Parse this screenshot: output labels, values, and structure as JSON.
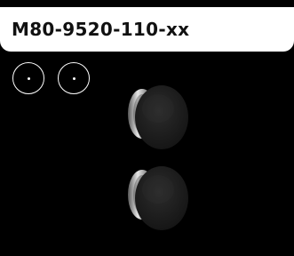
{
  "header": {
    "title": "M80-9520-110-xx"
  },
  "swatches": [
    {
      "icon": "color-swatch-icon",
      "selected": false
    },
    {
      "icon": "color-swatch-icon",
      "selected": false
    }
  ],
  "images": [
    {
      "icon": "black-knob-product-image"
    },
    {
      "icon": "black-knob-product-image"
    }
  ],
  "colors": {
    "background": "#000000",
    "header_bg": "#ffffff",
    "title_text": "#111111",
    "swatch_outline": "#ffffff",
    "knob_face": "#1f1f1f",
    "knob_metal": "#b8b8b8"
  }
}
